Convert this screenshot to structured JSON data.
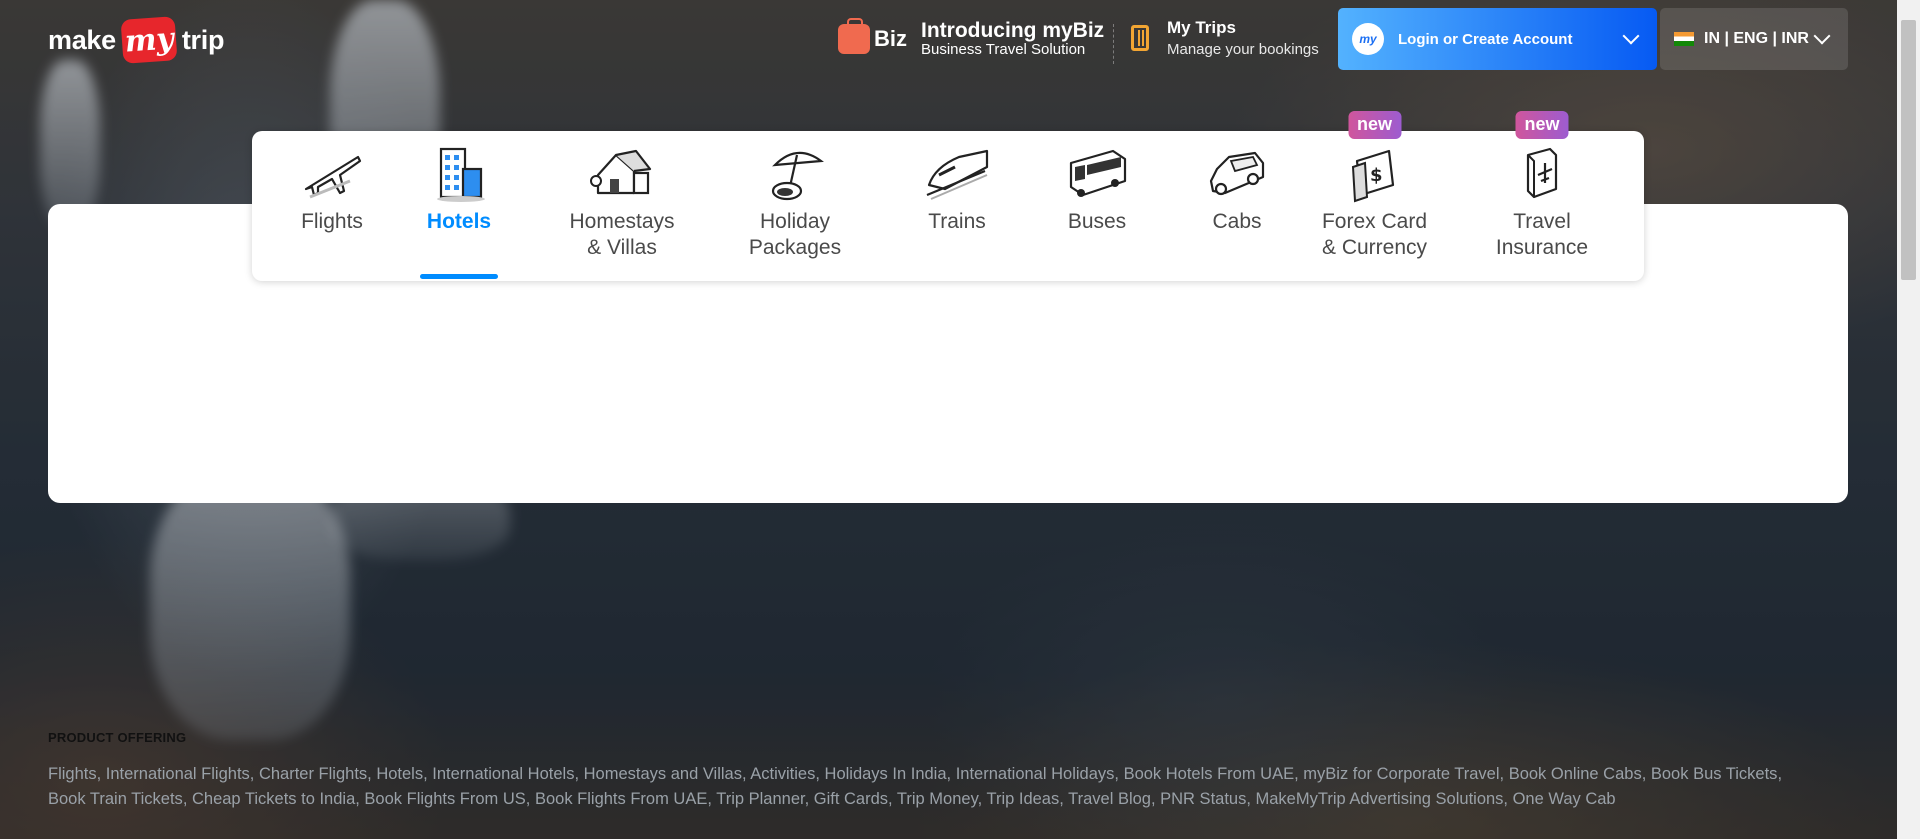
{
  "logo": {
    "pre": "make",
    "my": "my",
    "post": "trip"
  },
  "header": {
    "biz": {
      "word": "Biz",
      "title": "Introducing myBiz",
      "subtitle": "Business Travel Solution"
    },
    "trips": {
      "title": "My Trips",
      "subtitle": "Manage your bookings"
    },
    "login": {
      "avatar": "my",
      "label": "Login or Create Account"
    },
    "lang": {
      "label": "IN | ENG | INR"
    }
  },
  "nav": {
    "tabs": [
      {
        "label": "Flights",
        "icon": "airplane-icon"
      },
      {
        "label": "Hotels",
        "icon": "hotel-building-icon",
        "active": true
      },
      {
        "label": "Homestays\n& Villas",
        "icon": "house-icon"
      },
      {
        "label": "Holiday\nPackages",
        "icon": "umbrella-icon"
      },
      {
        "label": "Trains",
        "icon": "train-icon"
      },
      {
        "label": "Buses",
        "icon": "bus-icon"
      },
      {
        "label": "Cabs",
        "icon": "car-icon"
      },
      {
        "label": "Forex Card\n& Currency",
        "icon": "forex-card-icon",
        "badge": "new"
      },
      {
        "label": "Travel\nInsurance",
        "icon": "insurance-icon",
        "badge": "new"
      }
    ]
  },
  "footer": {
    "heading": "PRODUCT OFFERING",
    "links": [
      "Flights",
      "International Flights",
      "Charter Flights",
      "Hotels",
      "International Hotels",
      "Homestays and Villas",
      "Activities",
      "Holidays In India",
      "International Holidays",
      "Book Hotels From UAE",
      "myBiz for Corporate Travel",
      "Book Online Cabs",
      "Book Bus Tickets",
      "Book Train Tickets",
      "Cheap Tickets to India",
      "Book Flights From US",
      "Book Flights From UAE",
      "Trip Planner",
      "Gift Cards",
      "Trip Money",
      "Trip Ideas",
      "Travel Blog",
      "PNR Status",
      "MakeMyTrip Advertising Solutions",
      "One Way Cab"
    ]
  },
  "colors": {
    "accent": "#008cff",
    "brand_red": "#e7262c",
    "login_gradient_start": "#53b2fe",
    "login_gradient_end": "#065af3",
    "badge": "#b05fb8"
  }
}
